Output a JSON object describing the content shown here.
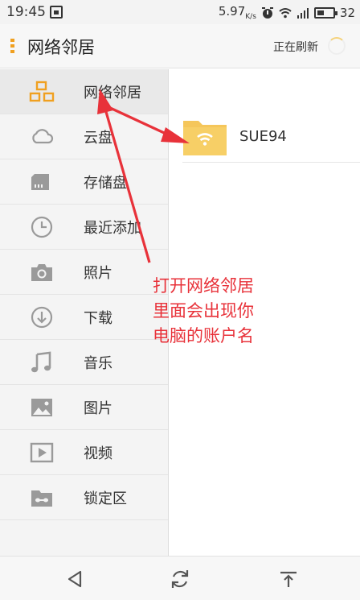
{
  "status_bar": {
    "time": "19:45",
    "speed": "5.97",
    "speed_unit": "K/s",
    "battery": "32"
  },
  "app_bar": {
    "title": "网络邻居",
    "refresh_text": "正在刷新"
  },
  "sidebar": {
    "items": [
      {
        "label": "网络邻居",
        "icon": "network-icon",
        "active": true
      },
      {
        "label": "云盘",
        "icon": "cloud-icon"
      },
      {
        "label": "存储盘",
        "icon": "storage-icon"
      },
      {
        "label": "最近添加",
        "icon": "clock-icon"
      },
      {
        "label": "照片",
        "icon": "camera-icon"
      },
      {
        "label": "下载",
        "icon": "download-icon"
      },
      {
        "label": "音乐",
        "icon": "music-icon"
      },
      {
        "label": "图片",
        "icon": "image-icon"
      },
      {
        "label": "视频",
        "icon": "video-icon"
      },
      {
        "label": "锁定区",
        "icon": "lock-area-icon"
      }
    ]
  },
  "main": {
    "files": [
      {
        "name": "SUE94",
        "icon": "network-folder-icon"
      }
    ]
  },
  "annotation": {
    "line1": "打开网络邻居",
    "line2": "里面会出现你",
    "line3": "电脑的账户名"
  },
  "colors": {
    "accent": "#f0a020",
    "annotation": "#e8323a",
    "folder": "#f5c65a"
  }
}
